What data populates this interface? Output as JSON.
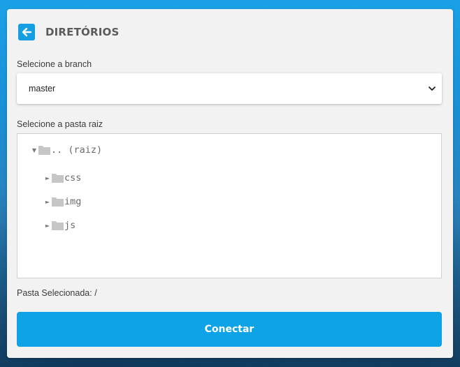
{
  "header": {
    "title": "DIRETÓRIOS",
    "back_icon": "arrow-left-icon"
  },
  "branch": {
    "label": "Selecione a branch",
    "selected": "master",
    "icon": "chevron-down-icon"
  },
  "folder": {
    "label": "Selecione a pasta raiz",
    "tree": [
      {
        "label": ".. (raiz)",
        "expanded": true,
        "icon": "folder-icon"
      },
      {
        "label": "css",
        "expanded": false,
        "icon": "folder-icon"
      },
      {
        "label": "img",
        "expanded": false,
        "icon": "folder-icon"
      },
      {
        "label": "js",
        "expanded": false,
        "icon": "folder-icon"
      }
    ]
  },
  "selected_folder": "Pasta Selecionada: /",
  "connect_button": "Conectar",
  "colors": {
    "accent": "#0ea3e6",
    "panel": "#f2f2f2",
    "folder": "#c6c6c6"
  }
}
